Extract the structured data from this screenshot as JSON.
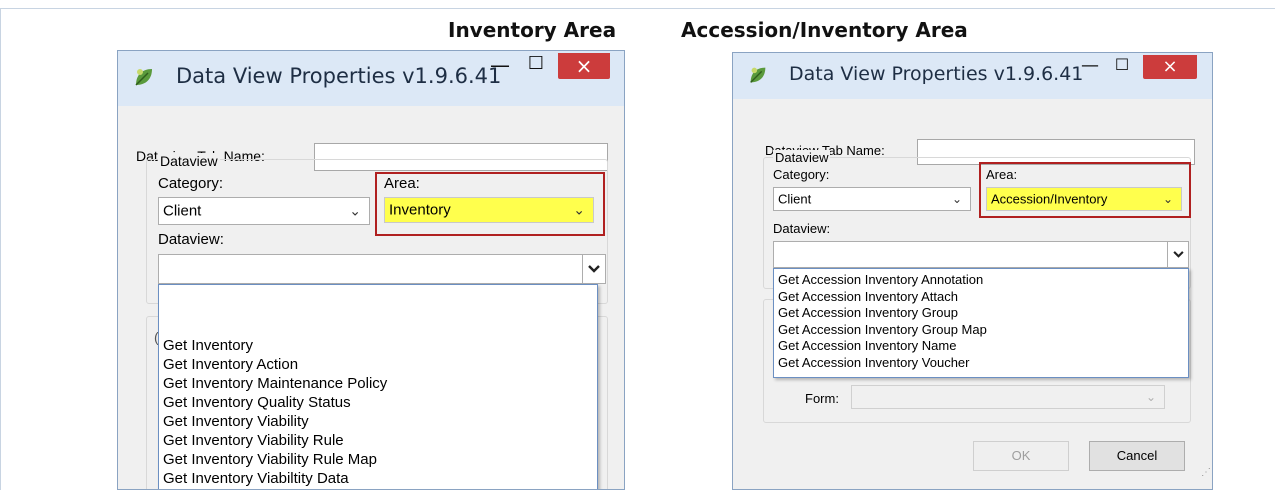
{
  "captions": {
    "left": "Inventory Area",
    "right": "Accession/Inventory Area"
  },
  "window_title": "Data View Properties v1.9.6.41",
  "window_controls": {
    "minimize": "—",
    "maximize": "☐",
    "close": "×"
  },
  "form": {
    "tab_name_label": "Dataview Tab Name:",
    "tab_name_value": "",
    "group_label": "Dataview",
    "category_label": "Category:",
    "area_label": "Area:",
    "dataview_label": "Dataview:",
    "form_label": "Form:",
    "ok_label": "OK",
    "cancel_label": "Cancel"
  },
  "left_dialog": {
    "category_value": "Client",
    "area_value": "Inventory",
    "dataview_value": "",
    "dropdown_items": [
      "Get Inventory",
      "Get Inventory Action",
      "Get Inventory Maintenance Policy",
      "Get Inventory Quality Status",
      "Get Inventory Viability",
      "Get Inventory Viability Rule",
      "Get Inventory Viability Rule Map",
      "Get Inventory Viabiltity Data"
    ]
  },
  "right_dialog": {
    "category_value": "Client",
    "area_value": "Accession/Inventory",
    "dataview_value": "",
    "form_value": "",
    "dropdown_items": [
      "Get Accession Inventory Annotation",
      "Get Accession Inventory Attach",
      "Get Accession Inventory Group",
      "Get Accession Inventory Group Map",
      "Get Accession Inventory Name",
      "Get Accession Inventory Voucher"
    ]
  },
  "colors": {
    "highlight_border": "#b02020",
    "area_fill": "#ffff4d",
    "titlebar": "#dce8f6",
    "close_button": "#cc3c3c"
  }
}
